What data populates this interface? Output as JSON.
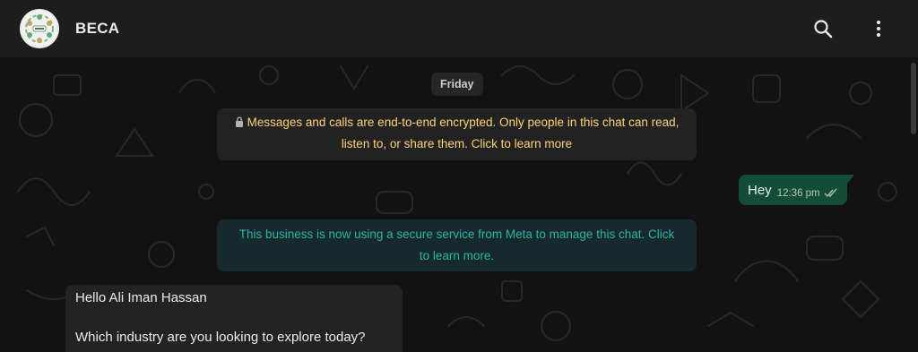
{
  "header": {
    "title": "BECA",
    "avatar_icon": "beca-logo-icon",
    "search_icon": "search-icon",
    "menu_icon": "kebab-menu-icon"
  },
  "chat": {
    "date_label": "Friday",
    "encryption_notice": {
      "icon": "lock-icon",
      "text": "Messages and calls are end-to-end encrypted. Only people in this chat can read, listen to, or share them. Click to learn more"
    },
    "outgoing": [
      {
        "text": "Hey",
        "time": "12:36 pm",
        "status_icon": "double-check-icon"
      }
    ],
    "business_notice": {
      "text": "This business is now using a secure service from Meta to manage this chat. Click to learn more."
    },
    "incoming": [
      {
        "line1": "Hello Ali Iman Hassan",
        "line2": "Which industry are you looking to explore today?"
      }
    ]
  },
  "colors": {
    "header_bg": "#1d1d1d",
    "chat_bg": "#121212",
    "outgoing_bubble": "#144d37",
    "incoming_bubble": "#232323",
    "system_text": "#ffd279",
    "business_text": "#2bb5a0"
  }
}
